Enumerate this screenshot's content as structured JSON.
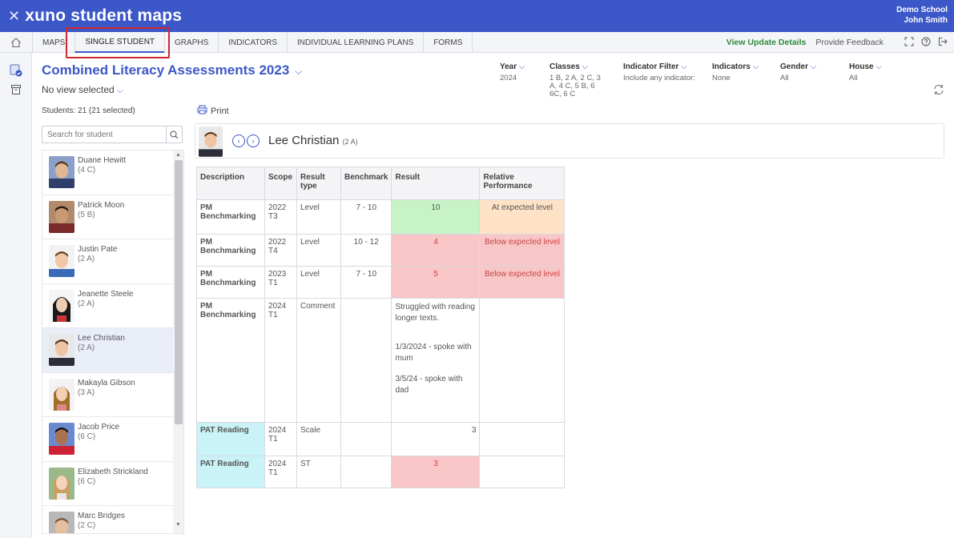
{
  "header": {
    "brand_prefix": "xuno",
    "brand_suffix": "student maps",
    "school": "Demo School",
    "user": "John Smith"
  },
  "nav": {
    "tabs": [
      {
        "label": "MAPS"
      },
      {
        "label": "SINGLE STUDENT"
      },
      {
        "label": "GRAPHS"
      },
      {
        "label": "INDICATORS"
      },
      {
        "label": "INDIVIDUAL LEARNING PLANS"
      },
      {
        "label": "FORMS"
      }
    ],
    "view_update": "View Update Details",
    "feedback": "Provide Feedback"
  },
  "page": {
    "title": "Combined Literacy Assessments 2023",
    "view_select": "No view selected"
  },
  "filters": [
    {
      "label": "Year",
      "value": "2024"
    },
    {
      "label": "Classes",
      "value": "1 B, 2 A, 2 C, 3 A, 4 C, 5 B, 6 6C, 6 C"
    },
    {
      "label": "Indicator Filter",
      "value": "Include any indicator:"
    },
    {
      "label": "Indicators",
      "value": "None"
    },
    {
      "label": "Gender",
      "value": "All"
    },
    {
      "label": "House",
      "value": "All"
    }
  ],
  "students": {
    "count_label": "Students: 21 (21 selected)",
    "search_placeholder": "Search for student",
    "print_label": "Print",
    "list": [
      {
        "name": "Duane Hewitt",
        "class": "(4 C)"
      },
      {
        "name": "Patrick Moon",
        "class": "(5 B)"
      },
      {
        "name": "Justin Pate",
        "class": "(2 A)"
      },
      {
        "name": "Jeanette Steele",
        "class": "(2 A)"
      },
      {
        "name": "Lee Christian",
        "class": "(2 A)"
      },
      {
        "name": "Makayla Gibson",
        "class": "(3 A)"
      },
      {
        "name": "Jacob Price",
        "class": "(6 C)"
      },
      {
        "name": "Elizabeth Strickland",
        "class": "(6 C)"
      },
      {
        "name": "Marc Bridges",
        "class": "(2 C)"
      }
    ]
  },
  "selected": {
    "name": "Lee Christian",
    "class": "(2 A)"
  },
  "table": {
    "headers": {
      "description": "Description",
      "scope": "Scope",
      "result_type": "Result type",
      "benchmark": "Benchmark",
      "result": "Result",
      "relative": "Relative Performance"
    },
    "rows": [
      {
        "description": "PM Benchmarking",
        "scope": "2022 T3",
        "type": "Level",
        "benchmark": "7 - 10",
        "result": "10",
        "relative": "At expected level"
      },
      {
        "description": "PM Benchmarking",
        "scope": "2022 T4",
        "type": "Level",
        "benchmark": "10 - 12",
        "result": "4",
        "relative": "Below expected level"
      },
      {
        "description": "PM Benchmarking",
        "scope": "2023 T1",
        "type": "Level",
        "benchmark": "7 - 10",
        "result": "5",
        "relative": "Below expected level"
      },
      {
        "description": "PM Benchmarking",
        "scope": "2024 T1",
        "type": "Comment",
        "benchmark": "",
        "comment1": "Struggled with reading longer texts.",
        "comment2": "1/3/2024 - spoke with mum",
        "comment3": "3/5/24 - spoke with dad",
        "relative": ""
      },
      {
        "description": "PAT Reading",
        "scope": "2024 T1",
        "type": "Scale",
        "benchmark": "",
        "result": "3",
        "relative": ""
      },
      {
        "description": "PAT Reading",
        "scope": "2024 T1",
        "type": "ST",
        "benchmark": "",
        "result": "3",
        "relative": ""
      }
    ]
  }
}
